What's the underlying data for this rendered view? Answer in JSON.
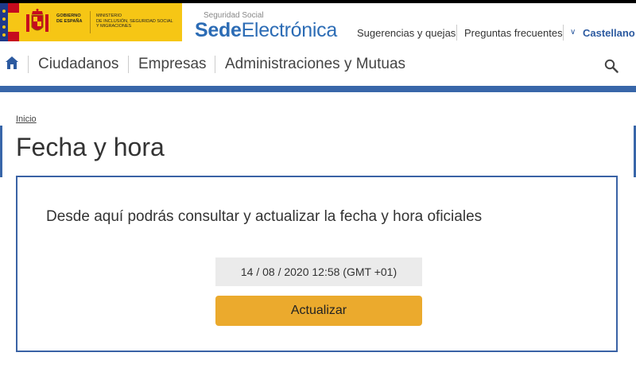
{
  "header": {
    "gov_line1": "GOBIERNO",
    "gov_line2": "DE ESPAÑA",
    "ministry_line1": "MINISTERIO",
    "ministry_line2": "DE INCLUSIÓN, SEGURIDAD SOCIAL",
    "ministry_line3": "Y MIGRACIONES",
    "sede_small": "Seguridad Social",
    "sede_bold": "Sede",
    "sede_rest": "Electrónica",
    "links": {
      "suggestions": "Sugerencias y quejas",
      "faq": "Preguntas frecuentes",
      "language": "Castellano"
    }
  },
  "nav": {
    "items": [
      "Ciudadanos",
      "Empresas",
      "Administraciones y Mutuas"
    ]
  },
  "breadcrumb": {
    "home": "Inicio"
  },
  "page": {
    "title": "Fecha y hora",
    "description": "Desde aquí podrás consultar y actualizar la fecha y hora oficiales",
    "datetime": "14 / 08 / 2020 12:58 (GMT +01)",
    "update_label": "Actualizar"
  },
  "colors": {
    "brand_blue": "#3866a9",
    "button": "#ebaa2d",
    "gov_yellow": "#f6c615"
  }
}
